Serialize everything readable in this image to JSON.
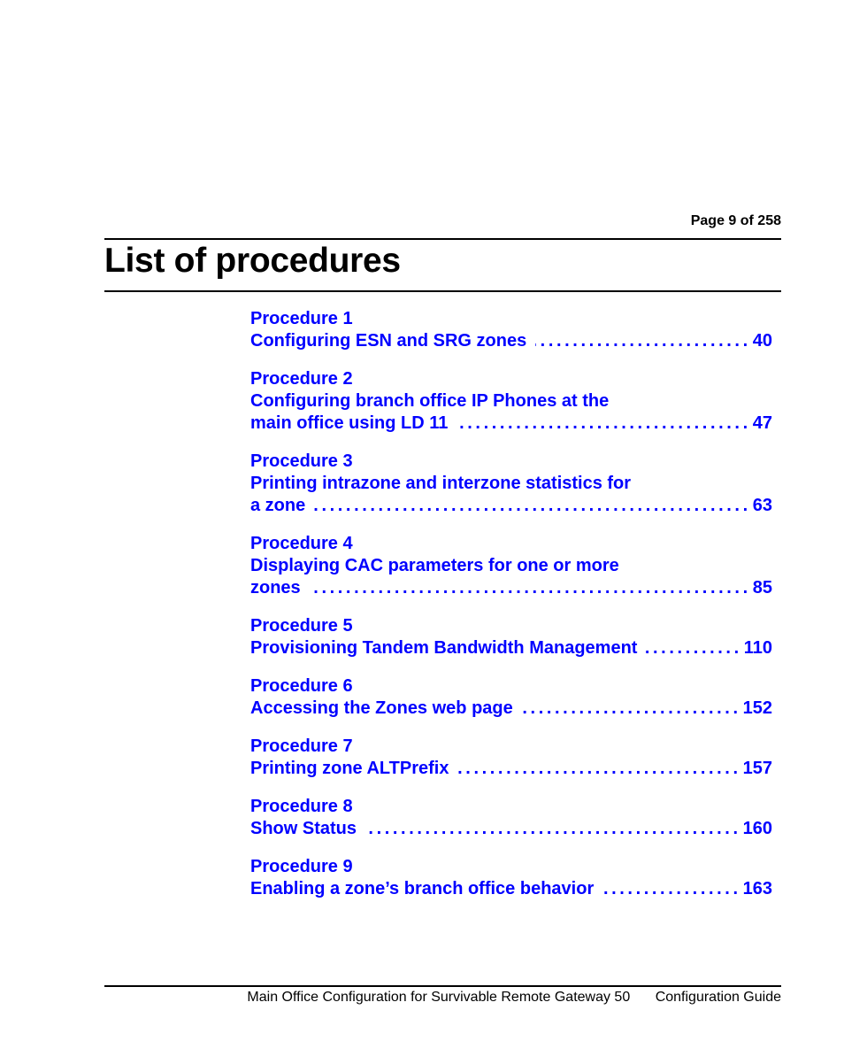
{
  "header": {
    "page_indicator": "Page 9 of 258"
  },
  "title": "List of procedures",
  "link_color": "#0000ff",
  "procedures": [
    {
      "label": "Procedure 1",
      "title_lines": [],
      "last_line": "Configuring ESN and SRG zones",
      "page": "40"
    },
    {
      "label": "Procedure 2",
      "title_lines": [
        "Configuring branch office IP Phones at the"
      ],
      "last_line": "main office using LD 11",
      "page": "47"
    },
    {
      "label": "Procedure 3",
      "title_lines": [
        "Printing intrazone and interzone statistics for"
      ],
      "last_line": "a zone",
      "page": "63"
    },
    {
      "label": "Procedure 4",
      "title_lines": [
        "Displaying CAC parameters for one or more"
      ],
      "last_line": "zones",
      "page": "85"
    },
    {
      "label": "Procedure 5",
      "title_lines": [],
      "last_line": "Provisioning Tandem Bandwidth Management",
      "page": "110"
    },
    {
      "label": "Procedure 6",
      "title_lines": [],
      "last_line": "Accessing the Zones web page",
      "page": "152"
    },
    {
      "label": "Procedure 7",
      "title_lines": [],
      "last_line": "Printing zone ALTPrefix",
      "page": "157"
    },
    {
      "label": "Procedure 8",
      "title_lines": [],
      "last_line": "Show Status",
      "page": "160"
    },
    {
      "label": "Procedure 9",
      "title_lines": [],
      "last_line": "Enabling a zone’s branch office behavior",
      "page": "163"
    }
  ],
  "leader_text": "..................................................................................",
  "footer": {
    "document_title": "Main Office Configuration for Survivable Remote Gateway 50",
    "document_type": "Configuration Guide"
  }
}
